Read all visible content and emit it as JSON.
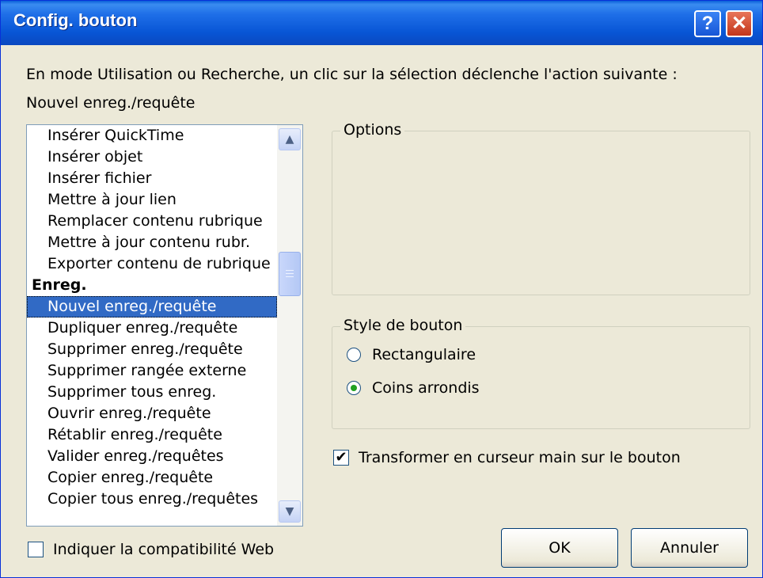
{
  "window": {
    "title": "Config. bouton",
    "help_label": "?",
    "close_label": "✕"
  },
  "description": "En mode Utilisation ou Recherche, un clic sur la sélection déclenche l'action suivante :",
  "current_action": "Nouvel enreg./requête",
  "action_list": {
    "items": [
      {
        "label": "Insérer QuickTime",
        "type": "item"
      },
      {
        "label": "Insérer objet",
        "type": "item"
      },
      {
        "label": "Insérer fichier",
        "type": "item"
      },
      {
        "label": "Mettre à jour lien",
        "type": "item"
      },
      {
        "label": "Remplacer contenu rubrique",
        "type": "item"
      },
      {
        "label": "Mettre à jour contenu rubr.",
        "type": "item"
      },
      {
        "label": "Exporter contenu de rubrique",
        "type": "item"
      },
      {
        "label": "Enreg.",
        "type": "category"
      },
      {
        "label": "Nouvel enreg./requête",
        "type": "item",
        "selected": true
      },
      {
        "label": "Dupliquer enreg./requête",
        "type": "item"
      },
      {
        "label": "Supprimer enreg./requête",
        "type": "item"
      },
      {
        "label": "Supprimer rangée externe",
        "type": "item"
      },
      {
        "label": "Supprimer tous enreg.",
        "type": "item"
      },
      {
        "label": "Ouvrir enreg./requête",
        "type": "item"
      },
      {
        "label": "Rétablir enreg./requête",
        "type": "item"
      },
      {
        "label": "Valider enreg./requêtes",
        "type": "item"
      },
      {
        "label": "Copier enreg./requête",
        "type": "item"
      },
      {
        "label": "Copier tous enreg./requêtes",
        "type": "item"
      }
    ],
    "scroll_up_icon": "▲",
    "scroll_down_icon": "▼"
  },
  "options_group": {
    "legend": "Options"
  },
  "style_group": {
    "legend": "Style de bouton",
    "options": [
      {
        "label": "Rectangulaire",
        "selected": false
      },
      {
        "label": "Coins arrondis",
        "selected": true
      }
    ]
  },
  "hand_cursor": {
    "label": "Transformer en curseur main sur le bouton",
    "checked": true,
    "mark": "✔"
  },
  "web_compat": {
    "label": "Indiquer la compatibilité Web",
    "checked": false
  },
  "buttons": {
    "ok": "OK",
    "cancel": "Annuler"
  },
  "colors": {
    "titlebar": "#0a54d8",
    "selection": "#316ac5",
    "dialog_bg": "#ece9d8",
    "close": "#c3361b"
  }
}
